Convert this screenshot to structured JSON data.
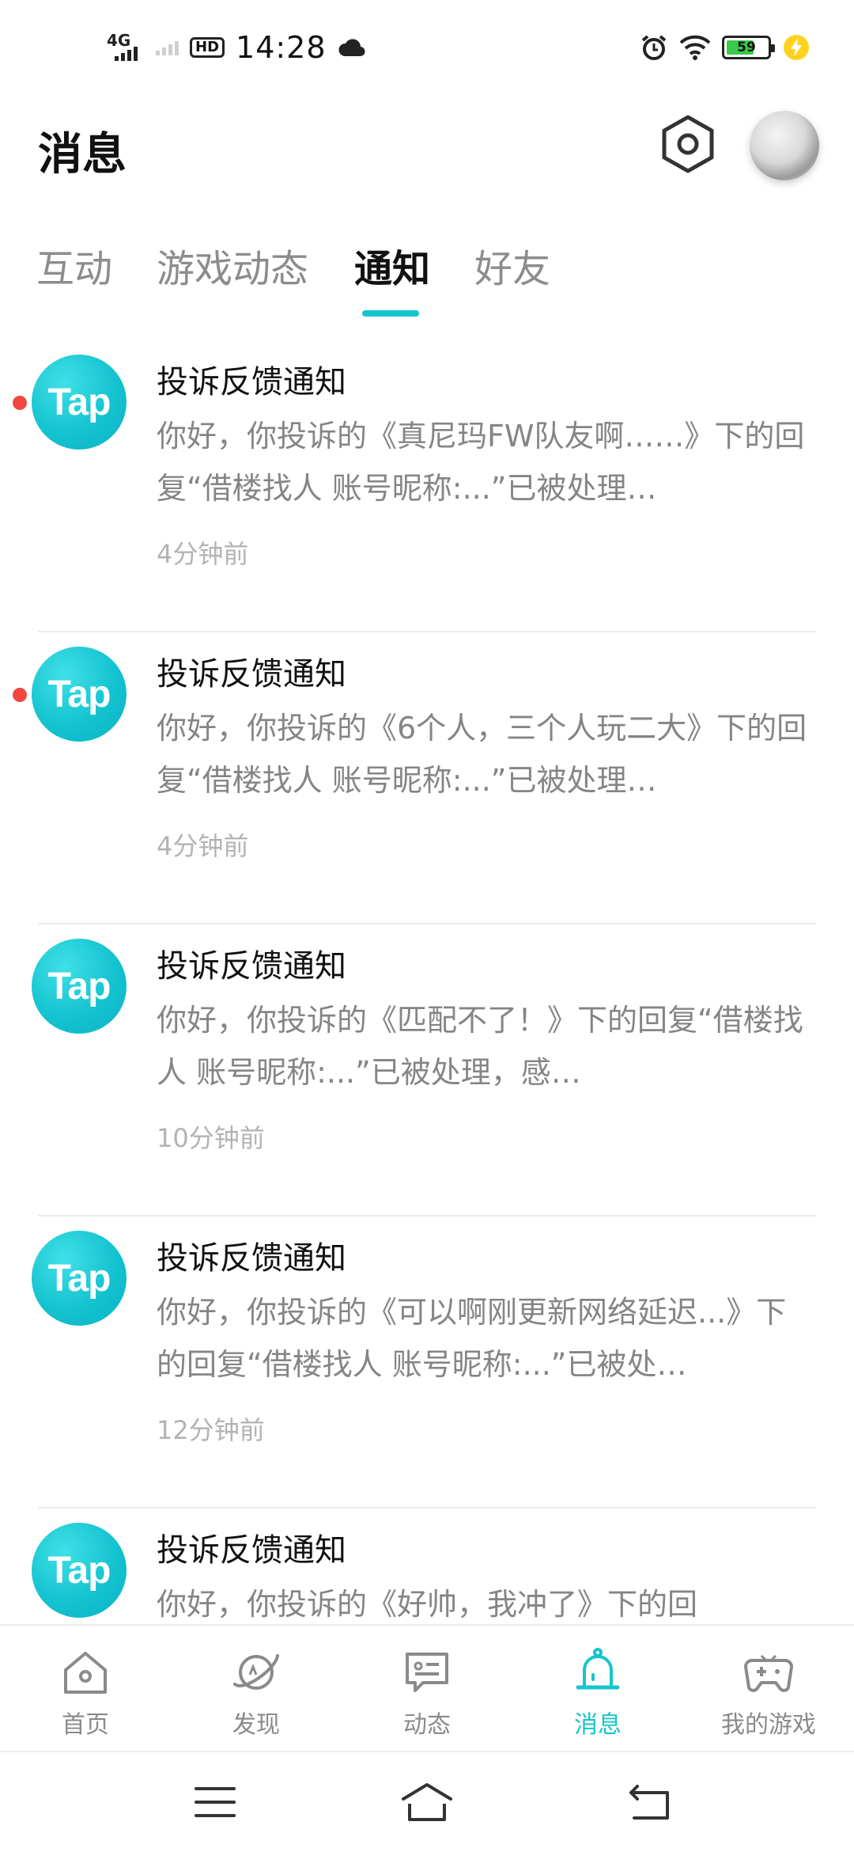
{
  "status_bar": {
    "network": "4G",
    "hd": "HD",
    "time": "14:28",
    "battery": "59"
  },
  "header": {
    "title": "消息"
  },
  "tabs": [
    {
      "label": "互动"
    },
    {
      "label": "游戏动态"
    },
    {
      "label": "通知"
    },
    {
      "label": "好友"
    }
  ],
  "active_tab": "通知",
  "notifications": [
    {
      "avatar_text": "Tap",
      "title": "投诉反馈通知",
      "body": "你好，你投诉的《真尼玛FW队友啊……》下的回复“借楼找人 账号昵称:...”已被处理…",
      "time": "4分钟前",
      "unread": true
    },
    {
      "avatar_text": "Tap",
      "title": "投诉反馈通知",
      "body": "你好，你投诉的《6个人，三个人玩二大》下的回复“借楼找人 账号昵称:...”已被处理…",
      "time": "4分钟前",
      "unread": true
    },
    {
      "avatar_text": "Tap",
      "title": "投诉反馈通知",
      "body": "你好，你投诉的《匹配不了！》下的回复“借楼找人 账号昵称:...”已被处理，感…",
      "time": "10分钟前",
      "unread": false
    },
    {
      "avatar_text": "Tap",
      "title": "投诉反馈通知",
      "body": "你好，你投诉的《可以啊刚更新网络延迟...》下的回复“借楼找人 账号昵称:...”已被处…",
      "time": "12分钟前",
      "unread": false
    },
    {
      "avatar_text": "Tap",
      "title": "投诉反馈通知",
      "body": "你好，你投诉的《好帅，我冲了》下的回",
      "time": "",
      "unread": false
    }
  ],
  "bottom_nav": [
    {
      "label": "首页",
      "icon": "home-icon"
    },
    {
      "label": "发现",
      "icon": "planet-icon"
    },
    {
      "label": "动态",
      "icon": "chat-bubble-icon"
    },
    {
      "label": "消息",
      "icon": "bell-icon"
    },
    {
      "label": "我的游戏",
      "icon": "gamepad-icon"
    }
  ],
  "active_nav": "消息",
  "colors": {
    "accent": "#15c5ce",
    "unread_dot": "#f0483e",
    "battery": "#3ac94a"
  }
}
